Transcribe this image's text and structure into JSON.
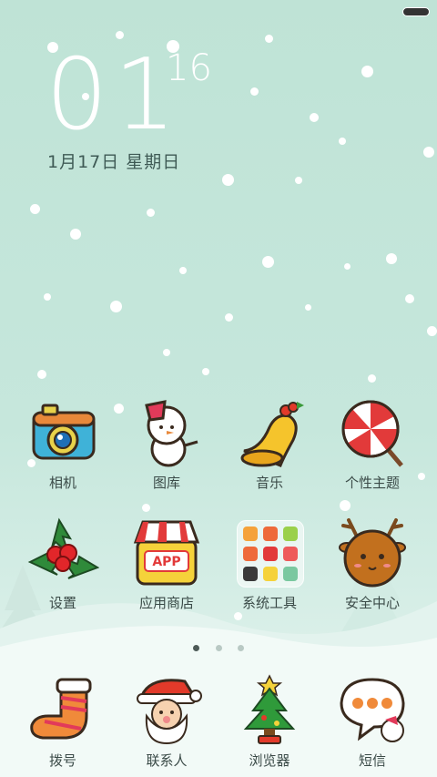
{
  "status_bar": {
    "battery_icon": "battery-icon"
  },
  "clock": {
    "hour": "01",
    "minute": "16",
    "date": "1月17日 星期日"
  },
  "apps": [
    {
      "label": "相机",
      "icon": "camera-icon"
    },
    {
      "label": "图库",
      "icon": "snowman-icon"
    },
    {
      "label": "音乐",
      "icon": "bell-icon"
    },
    {
      "label": "个性主题",
      "icon": "lollipop-icon"
    },
    {
      "label": "设置",
      "icon": "holly-icon"
    },
    {
      "label": "应用商店",
      "icon": "app-store-icon",
      "badge_text": "APP"
    },
    {
      "label": "系统工具",
      "icon": "folder-icon"
    },
    {
      "label": "安全中心",
      "icon": "reindeer-icon"
    }
  ],
  "page_indicator": {
    "count": 3,
    "active": 0
  },
  "dock": [
    {
      "label": "拨号",
      "icon": "stocking-icon"
    },
    {
      "label": "联系人",
      "icon": "santa-icon"
    },
    {
      "label": "浏览器",
      "icon": "christmas-tree-icon"
    },
    {
      "label": "短信",
      "icon": "chat-bubble-icon"
    }
  ],
  "colors": {
    "background": "#c3e5da",
    "label": "#3b4b48",
    "date": "#3f5a55"
  }
}
